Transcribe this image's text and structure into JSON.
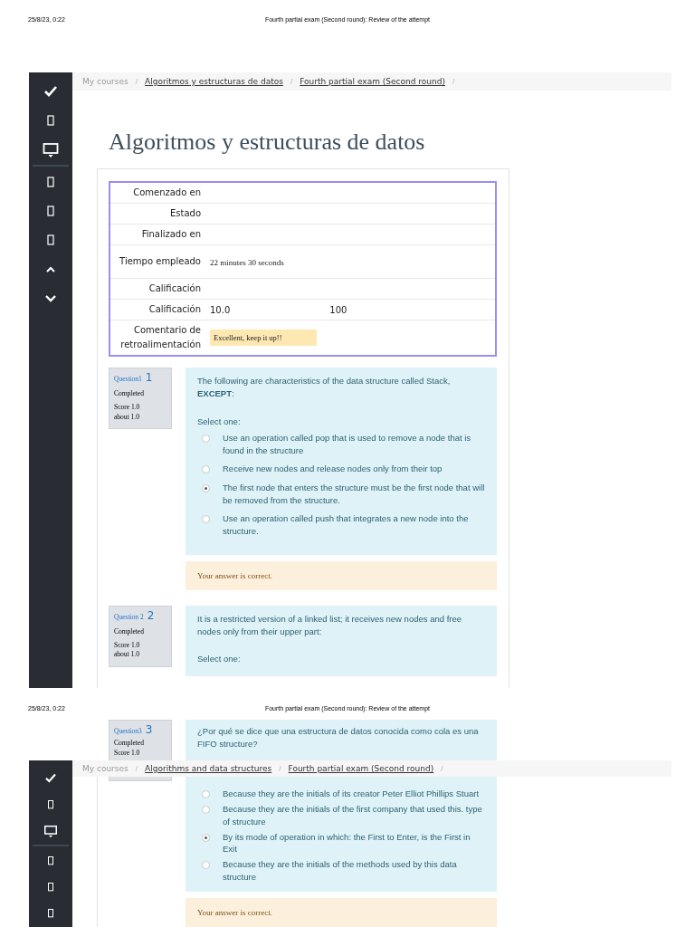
{
  "page_1": {
    "header": {
      "date": "25/8/23, 0:22",
      "title": "Fourth partial exam (Second round): Review of the attempt"
    },
    "breadcrumb": {
      "separator": "/",
      "items": [
        {
          "label": "My courses",
          "kind": "plain"
        },
        {
          "label": "Algoritmos y estructuras de datos",
          "kind": "link"
        },
        {
          "label": "Fourth partial exam (Second round)",
          "kind": "link"
        }
      ]
    },
    "heading": "Algoritmos y estructuras de datos",
    "summary": [
      {
        "label": "Comenzado en",
        "kind": "plain"
      },
      {
        "label": "Estado",
        "kind": "plain"
      },
      {
        "label": "Finalizado en",
        "kind": "plain"
      },
      {
        "label": "Tiempo empleado",
        "value": "22 minutes 30 seconds",
        "kind": "time"
      },
      {
        "label": "Calificación",
        "kind": "plain"
      },
      {
        "label": "Calificación",
        "value": "10.0",
        "extra": "100",
        "kind": "plain"
      },
      {
        "label": "Comentario de retroalimentación",
        "value": "Excellent, keep it up!!",
        "kind": "feedback"
      }
    ],
    "questions": [
      {
        "label": "Question1",
        "number": "1",
        "state": "Completed",
        "score": "Score 1.0",
        "about": "about 1.0",
        "text": "The following are characteristics of the data structure called Stack, **EXCEPT**:",
        "prompt": "Select one:",
        "options": [
          {
            "text": "Use an operation called pop that is used to remove a node that is found in the structure",
            "selected": false
          },
          {
            "text": "Receive new nodes and release nodes only from their top",
            "selected": false
          },
          {
            "text": "The first node that enters the structure must be the first node that will be removed from the structure.",
            "selected": true
          },
          {
            "text": "Use an operation called push that integrates a new node into the structure.",
            "selected": false
          }
        ],
        "feedback": "Your answer is correct."
      },
      {
        "label": "Question 2",
        "number": "2",
        "state": "Completed",
        "score": "Score 1.0",
        "about": "about 1.0",
        "text": "It is a restricted version of a linked list; it receives new nodes and free nodes only from their upper part:",
        "prompt": "Select one:"
      }
    ]
  },
  "page_2": {
    "header": {
      "date": "25/8/23, 0:22",
      "title": "Fourth partial exam (Second round): Review of the attempt"
    },
    "question": {
      "label": "Question3",
      "number": "3",
      "state": "Completed",
      "score": "Score 1.0",
      "text": "¿Por qué se dice que una estructura de datos conocida como cola es una FIFO structure?",
      "options": [
        {
          "text": "Because they are the initials of its creator Peter Elliot Phillips Stuart",
          "selected": false
        },
        {
          "text": "Because they are the initials of the first company that used this. type of structure",
          "selected": false
        },
        {
          "text": "By its mode of operation in which: the First to Enter, is the First in Exit",
          "selected": true
        },
        {
          "text": "Because they are the initials of the methods used by this data structure",
          "selected": false
        }
      ],
      "feedback": "Your answer is correct."
    },
    "breadcrumb": {
      "separator": "/",
      "items": [
        {
          "label": "My courses",
          "kind": "plain"
        },
        {
          "label": "Algorithms and data structures",
          "kind": "link"
        },
        {
          "label": "Fourth partial exam (Second round)",
          "kind": "link"
        }
      ]
    }
  }
}
